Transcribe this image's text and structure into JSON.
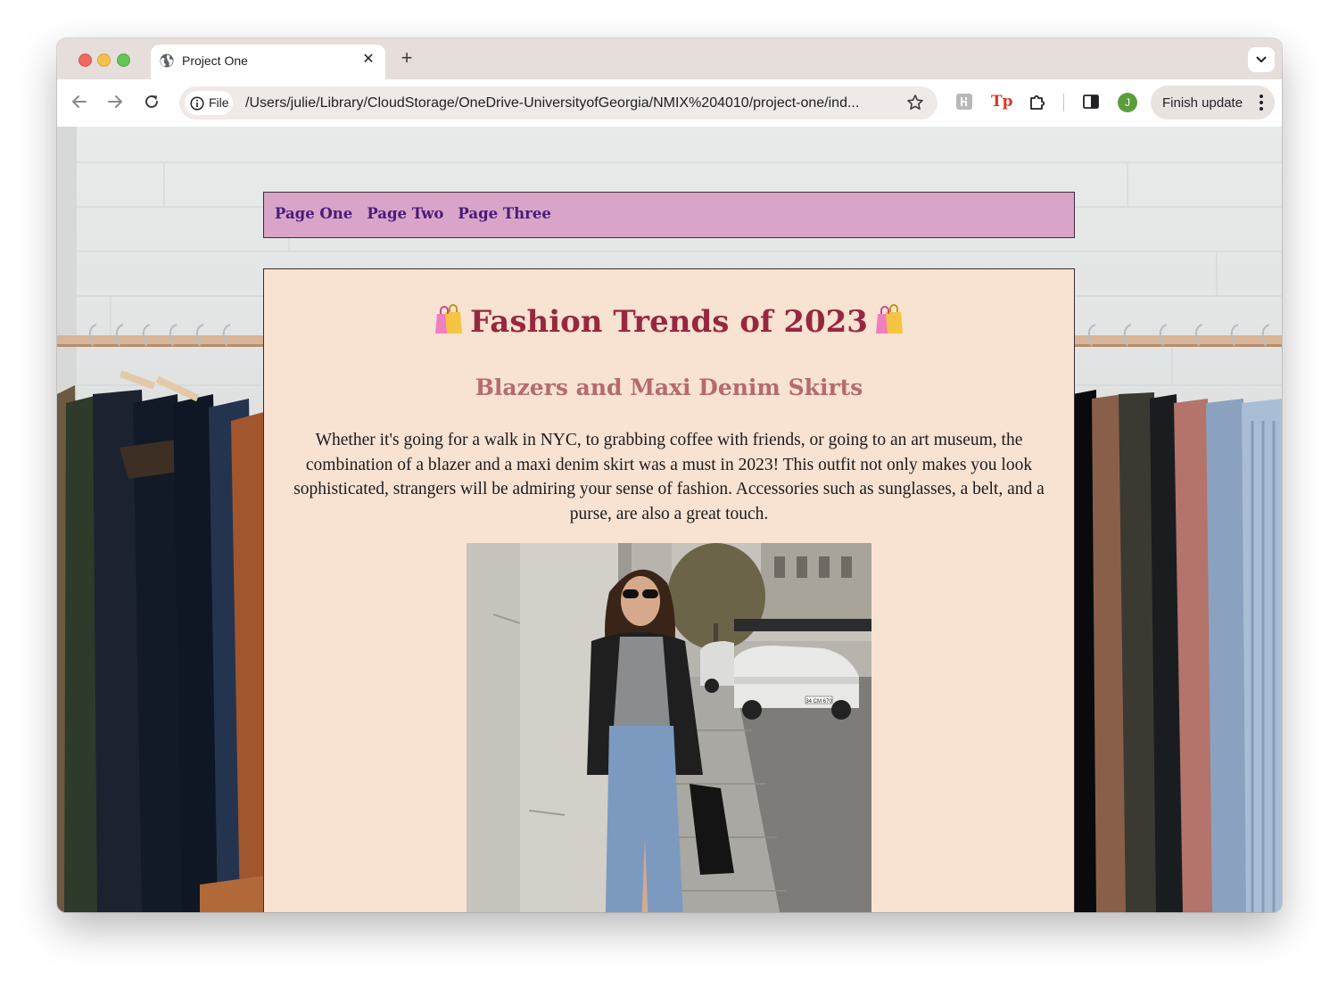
{
  "browser": {
    "tab_title": "Project One",
    "omnibox": {
      "scheme_label": "File",
      "url": "/Users/julie/Library/CloudStorage/OneDrive-UniversityofGeorgia/NMIX%204010/project-one/ind..."
    },
    "profile_initial": "J",
    "finish_update_label": "Finish update",
    "extensions": [
      "grey-extension-icon",
      "tp-extension-icon",
      "puzzle-extensions-icon"
    ],
    "tp_extension_text": "Tp"
  },
  "page": {
    "nav": [
      "Page One",
      "Page Two",
      "Page Three"
    ],
    "title": "Fashion Trends of 2023",
    "subtitle": "Blazers and Maxi Denim Skirts",
    "body": "Whether it's going for a walk in NYC, to grabbing coffee with friends, or going to an art museum, the combination of a blazer and a maxi denim skirt was a must in 2023! This outfit not only makes you look sophisticated, strangers will be admiring your sense of fashion. Accessories such as sunglasses, a belt, and a purse, are also a great touch.",
    "photo_plate": "34 CM 670",
    "colors": {
      "nav_bg": "#d8a5c9",
      "nav_link": "#4b1a79",
      "panel_bg": "#f8e2d2",
      "title": "#97273f",
      "subtitle": "#b56b6b"
    }
  }
}
